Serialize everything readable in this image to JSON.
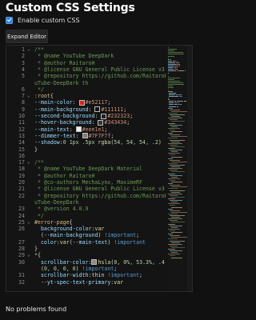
{
  "page": {
    "title": "Custom CSS Settings"
  },
  "settings": {
    "enable_label": "Enable custom CSS",
    "enable_checked": true,
    "expand_button": "Expand Editor"
  },
  "editor": {
    "lines": [
      {
        "n": "1",
        "fold": "v",
        "tokens": [
          [
            "com",
            "/**"
          ]
        ]
      },
      {
        "n": "2",
        "tokens": [
          [
            "com",
            " * @name YouTube DeepDark"
          ]
        ]
      },
      {
        "n": "3",
        "tokens": [
          [
            "com",
            " * @author RaitaroH"
          ]
        ]
      },
      {
        "n": "4",
        "tokens": [
          [
            "com",
            " * @license GNU General Public License v3.0"
          ]
        ]
      },
      {
        "n": "5",
        "tokens": [
          [
            "com",
            " * @repository https://github.com/RaitaroH/Yo"
          ]
        ]
      },
      {
        "n": "",
        "tokens": [
          [
            "com",
            "uTube-DeepDark th"
          ]
        ]
      },
      {
        "n": "6",
        "tokens": [
          [
            "com",
            " */"
          ]
        ]
      },
      {
        "n": "7",
        "fold": "v",
        "tokens": [
          [
            "sel",
            ":root"
          ],
          [
            "pun",
            "{"
          ]
        ]
      },
      {
        "n": "8",
        "tokens": [
          [
            "prop",
            "--main-color"
          ],
          [
            "pun",
            ": "
          ],
          [
            "sw",
            "#e52117"
          ],
          [
            "str",
            "#e52117"
          ],
          [
            "pun",
            ";"
          ]
        ]
      },
      {
        "n": "9",
        "tokens": [
          [
            "prop",
            "--main-background"
          ],
          [
            "pun",
            ": "
          ],
          [
            "sw",
            "#111111"
          ],
          [
            "str",
            "#111111"
          ],
          [
            "pun",
            ";"
          ]
        ]
      },
      {
        "n": "10",
        "tokens": [
          [
            "prop",
            "--second-background"
          ],
          [
            "pun",
            ": "
          ],
          [
            "sw",
            "#232323"
          ],
          [
            "str",
            "#232323"
          ],
          [
            "pun",
            ";"
          ]
        ]
      },
      {
        "n": "11",
        "tokens": [
          [
            "prop",
            "--hover-background"
          ],
          [
            "pun",
            ": "
          ],
          [
            "sw",
            "#343434"
          ],
          [
            "str",
            "#343434"
          ],
          [
            "pun",
            ";"
          ]
        ]
      },
      {
        "n": "12",
        "tokens": [
          [
            "prop",
            "--main-text"
          ],
          [
            "pun",
            ": "
          ],
          [
            "sw",
            "#eeeeee"
          ],
          [
            "str",
            "#eee1e1"
          ],
          [
            "pun",
            ";"
          ]
        ]
      },
      {
        "n": "13",
        "tokens": [
          [
            "prop",
            "--dimmer-text"
          ],
          [
            "pun",
            ": "
          ],
          [
            "sw",
            "#7f7f7f"
          ],
          [
            "str",
            "#7F7F7f"
          ],
          [
            "pun",
            ";"
          ]
        ]
      },
      {
        "n": "14",
        "tokens": [
          [
            "prop",
            "--shadow"
          ],
          [
            "pun",
            ":"
          ],
          [
            "num",
            "0 1px .5px "
          ],
          [
            "fn",
            "rgba"
          ],
          [
            "pun",
            "("
          ],
          [
            "num",
            "54, 54, 54, .2"
          ],
          [
            "pun",
            ")"
          ]
        ]
      },
      {
        "n": "15",
        "tokens": [
          [
            "pun",
            "}"
          ]
        ]
      },
      {
        "n": "16",
        "tokens": []
      },
      {
        "n": "17",
        "fold": "v",
        "tokens": [
          [
            "com",
            "/**"
          ]
        ]
      },
      {
        "n": "18",
        "tokens": [
          [
            "com",
            " * @name YouTube DeepDark Material"
          ]
        ]
      },
      {
        "n": "19",
        "tokens": [
          [
            "com",
            " * @author RaitaroH"
          ]
        ]
      },
      {
        "n": "20",
        "tokens": [
          [
            "com",
            " * @co-authors MechaLynx, MaximeRF"
          ]
        ]
      },
      {
        "n": "21",
        "tokens": [
          [
            "com",
            " * @license GNU General Public License v3.0"
          ]
        ]
      },
      {
        "n": "22",
        "tokens": [
          [
            "com",
            " * @repository https://github.com/RaitaroH/Yo"
          ]
        ]
      },
      {
        "n": "",
        "tokens": [
          [
            "com",
            "uTube-DeepDark"
          ]
        ]
      },
      {
        "n": "23",
        "tokens": [
          [
            "com",
            " * @version 4.0.9"
          ]
        ]
      },
      {
        "n": "24",
        "tokens": [
          [
            "com",
            " */"
          ]
        ]
      },
      {
        "n": "25",
        "fold": "v",
        "tokens": [
          [
            "sel",
            "#error-page"
          ],
          [
            "pun",
            "{"
          ]
        ]
      },
      {
        "n": "26",
        "tokens": [
          [
            "plain",
            "  "
          ],
          [
            "prop",
            "background-color"
          ],
          [
            "pun",
            ":"
          ],
          [
            "fn",
            "var"
          ]
        ]
      },
      {
        "n": "",
        "tokens": [
          [
            "plain",
            "  "
          ],
          [
            "pun",
            "("
          ],
          [
            "prop",
            "--main-background"
          ],
          [
            "pun",
            ") "
          ],
          [
            "imp",
            "!important"
          ],
          [
            "pun",
            ";"
          ]
        ]
      },
      {
        "n": "27",
        "tokens": [
          [
            "plain",
            "  "
          ],
          [
            "prop",
            "color"
          ],
          [
            "pun",
            ":"
          ],
          [
            "fn",
            "var"
          ],
          [
            "pun",
            "("
          ],
          [
            "prop",
            "--main-text"
          ],
          [
            "pun",
            ") "
          ],
          [
            "imp",
            "!important"
          ]
        ]
      },
      {
        "n": "28",
        "tokens": [
          [
            "pun",
            "}"
          ]
        ]
      },
      {
        "n": "29",
        "fold": "v",
        "tokens": [
          [
            "sel",
            "*"
          ],
          [
            "pun",
            "{"
          ]
        ]
      },
      {
        "n": "30",
        "tokens": [
          [
            "plain",
            "  "
          ],
          [
            "prop",
            "scrollbar-color"
          ],
          [
            "pun",
            ":"
          ],
          [
            "sw",
            "#8a8a8a"
          ],
          [
            "fn",
            "hsla"
          ],
          [
            "pun",
            "("
          ],
          [
            "num",
            "0, 0%, 53.3%, .4"
          ],
          [
            "pun",
            ") "
          ],
          [
            "sw",
            "#000000"
          ],
          [
            "fn",
            "rgba"
          ]
        ]
      },
      {
        "n": "",
        "tokens": [
          [
            "plain",
            "  "
          ],
          [
            "pun",
            "("
          ],
          [
            "num",
            "0, 0, 0, 0"
          ],
          [
            "pun",
            ") "
          ],
          [
            "imp",
            "!important"
          ],
          [
            "pun",
            ";"
          ]
        ]
      },
      {
        "n": "31",
        "tokens": [
          [
            "plain",
            "  "
          ],
          [
            "prop",
            "scrollbar-width"
          ],
          [
            "pun",
            ":"
          ],
          [
            "plain",
            "thin "
          ],
          [
            "imp",
            "!important"
          ],
          [
            "pun",
            ";"
          ]
        ]
      },
      {
        "n": "32",
        "tokens": [
          [
            "plain",
            "  "
          ],
          [
            "prop",
            "--yt-spec-text-primary"
          ],
          [
            "pun",
            ":"
          ],
          [
            "fn",
            "var"
          ]
        ]
      }
    ]
  },
  "status": {
    "problems": "No problems found"
  }
}
